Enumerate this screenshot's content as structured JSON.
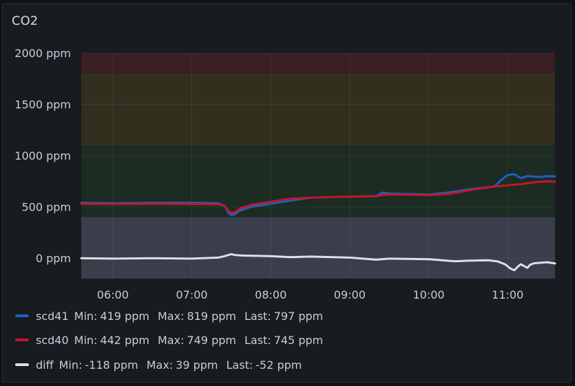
{
  "panel": {
    "title": "CO2"
  },
  "legend": [
    {
      "name": "scd41",
      "color": "#1f60c4",
      "min_label": "Min:",
      "min": "419 ppm",
      "max_label": "Max:",
      "max": "819 ppm",
      "last_label": "Last:",
      "last": "797 ppm"
    },
    {
      "name": "scd40",
      "color": "#c4162a",
      "min_label": "Min:",
      "min": "442 ppm",
      "max_label": "Max:",
      "max": "749 ppm",
      "last_label": "Last:",
      "last": "745 ppm"
    },
    {
      "name": "diff",
      "color": "#e0e0e6",
      "min_label": "Min:",
      "min": "-118 ppm",
      "max_label": "Max:",
      "max": "39 ppm",
      "last_label": "Last:",
      "last": "-52 ppm"
    }
  ],
  "chart_data": {
    "type": "line",
    "title": "CO2",
    "unit": "ppm",
    "ylim": [
      -200,
      2000
    ],
    "yticks": [
      0,
      500,
      1000,
      1500,
      2000
    ],
    "ytick_labels": [
      "0 ppm",
      "500 ppm",
      "1000 ppm",
      "1500 ppm",
      "2000 ppm"
    ],
    "xlim": [
      "05:36",
      "11:36"
    ],
    "xticks": [
      "06:00",
      "07:00",
      "08:00",
      "09:00",
      "10:00",
      "11:00"
    ],
    "grid": true,
    "thresholds": [
      {
        "from": -200,
        "to": 400,
        "color": "#3a3d4a"
      },
      {
        "from": 400,
        "to": 1100,
        "color": "#1c2c22"
      },
      {
        "from": 1100,
        "to": 1800,
        "color": "#332f1f"
      },
      {
        "from": 1800,
        "to": 2000,
        "color": "#3a1f24"
      }
    ],
    "series": [
      {
        "name": "scd41",
        "color": "#1f60c4",
        "x": [
          "05:36",
          "06:00",
          "06:30",
          "07:00",
          "07:20",
          "07:25",
          "07:28",
          "07:30",
          "07:33",
          "07:36",
          "07:45",
          "08:00",
          "08:15",
          "08:30",
          "09:00",
          "09:20",
          "09:25",
          "09:30",
          "10:00",
          "10:15",
          "10:30",
          "10:45",
          "10:50",
          "10:55",
          "11:00",
          "11:05",
          "11:10",
          "11:15",
          "11:25",
          "11:30",
          "11:36"
        ],
        "values": [
          540,
          535,
          540,
          540,
          535,
          510,
          440,
          419,
          430,
          460,
          500,
          530,
          560,
          590,
          600,
          605,
          640,
          630,
          620,
          640,
          670,
          690,
          700,
          760,
          810,
          819,
          780,
          800,
          790,
          800,
          797
        ]
      },
      {
        "name": "scd40",
        "color": "#c4162a",
        "x": [
          "05:36",
          "06:00",
          "06:30",
          "07:00",
          "07:20",
          "07:25",
          "07:28",
          "07:30",
          "07:33",
          "07:36",
          "07:45",
          "08:00",
          "08:15",
          "08:30",
          "09:00",
          "09:20",
          "09:25",
          "09:30",
          "10:00",
          "10:15",
          "10:30",
          "10:45",
          "11:00",
          "11:10",
          "11:20",
          "11:30",
          "11:36"
        ],
        "values": [
          530,
          528,
          530,
          528,
          525,
          510,
          460,
          442,
          450,
          480,
          520,
          550,
          580,
          590,
          600,
          603,
          615,
          620,
          615,
          625,
          660,
          690,
          710,
          720,
          740,
          749,
          745
        ]
      },
      {
        "name": "diff",
        "color": "#e0e0e6",
        "x": [
          "05:36",
          "06:00",
          "06:30",
          "07:00",
          "07:20",
          "07:25",
          "07:30",
          "07:33",
          "07:40",
          "08:00",
          "08:15",
          "08:30",
          "09:00",
          "09:20",
          "09:30",
          "10:00",
          "10:10",
          "10:20",
          "10:30",
          "10:45",
          "10:52",
          "10:58",
          "11:02",
          "11:05",
          "11:08",
          "11:10",
          "11:15",
          "11:17",
          "11:20",
          "11:30",
          "11:36"
        ],
        "values": [
          0,
          -5,
          0,
          -5,
          5,
          20,
          39,
          30,
          25,
          20,
          10,
          15,
          5,
          -15,
          -5,
          -10,
          -20,
          -30,
          -25,
          -20,
          -30,
          -60,
          -100,
          -118,
          -80,
          -60,
          -95,
          -65,
          -50,
          -40,
          -52
        ]
      }
    ]
  }
}
